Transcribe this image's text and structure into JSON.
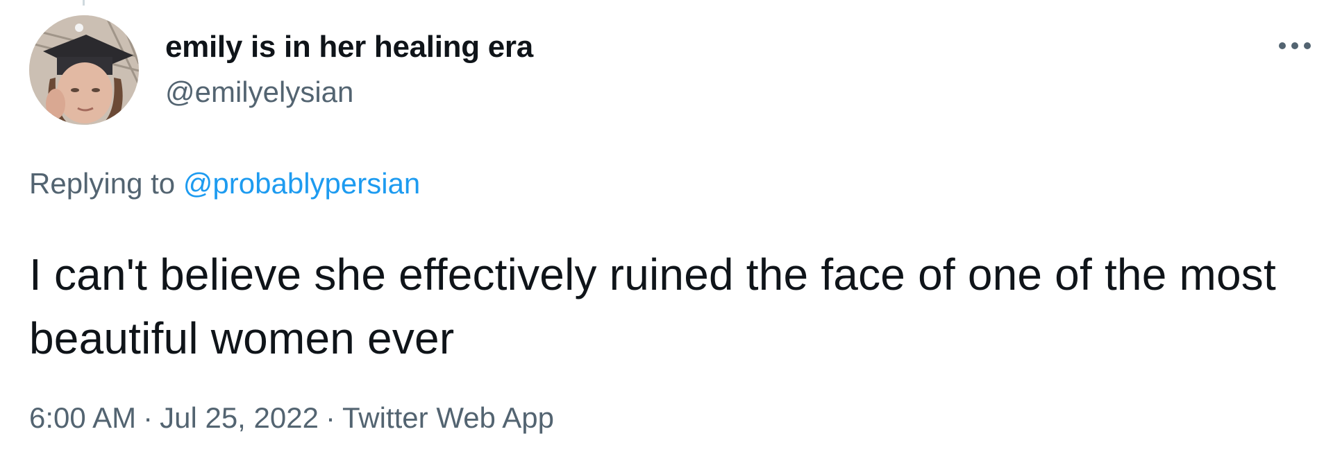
{
  "author": {
    "display_name": "emily is in her healing era",
    "handle": "@emilyelysian",
    "avatar_icon": "user-avatar-photo"
  },
  "reply": {
    "prefix": "Replying to",
    "mention": "@probablypersian"
  },
  "tweet": {
    "text": "I can't believe she effectively ruined the face of one of the most beautiful women ever"
  },
  "meta": {
    "time": "6:00 AM",
    "separator": "·",
    "date": "Jul 25, 2022",
    "source": "Twitter Web App"
  },
  "icons": {
    "more": "more-horizontal-icon"
  },
  "colors": {
    "text_primary": "#0f1419",
    "text_secondary": "#536471",
    "link": "#1d9bf0"
  }
}
